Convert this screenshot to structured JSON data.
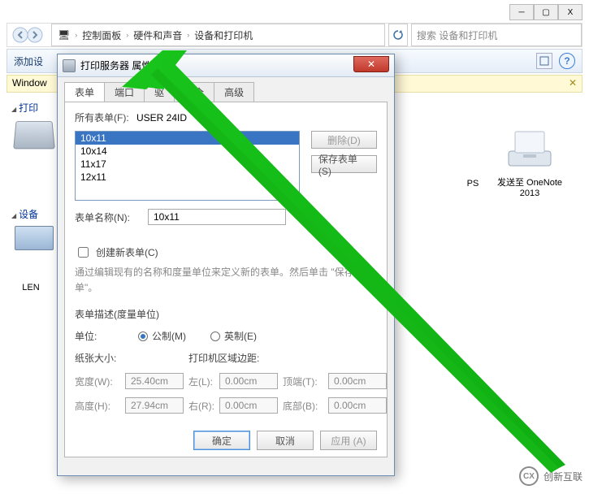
{
  "window": {
    "minimize": "─",
    "maximize": "▢",
    "close": "X"
  },
  "breadcrumb": {
    "icon": "🖥",
    "seg1": "控制面板",
    "seg2": "硬件和声音",
    "seg3": "设备和打印机",
    "sep": "›"
  },
  "search": {
    "placeholder": "搜索 设备和打印机"
  },
  "toolbar": {
    "add_device": "添加设"
  },
  "infobar": {
    "text": "Window"
  },
  "side": {
    "cat_printers": "打印",
    "cat_devices": "设备"
  },
  "devices": {
    "onenote_line1": "发送至 OneNote",
    "onenote_line2": "2013",
    "ps_suffix": "PS",
    "len_label": "LEN"
  },
  "dialog": {
    "title": "打印服务器 属性",
    "tabs": {
      "forms": "表单",
      "ports": "端口",
      "drv": "驱",
      "sec": "安全",
      "adv": "高级"
    },
    "all_forms_label": "所有表单(F):",
    "all_forms_value": "USER             24ID",
    "list": [
      "10x11",
      "10x14",
      "11x17",
      "12x11"
    ],
    "delete_btn": "删除(D)",
    "save_btn": "保存表单(S)",
    "form_name_label": "表单名称(N):",
    "form_name_value": "10x11",
    "create_checkbox": "创建新表单(C)",
    "description": "通过编辑现有的名称和度量单位来定义新的表单。然后单击 \"保存表单\"。",
    "section_title": "表单描述(度量单位)",
    "unit_label": "单位:",
    "metric_label": "公制(M)",
    "imperial_label": "英制(E)",
    "paper_size": "纸张大小:",
    "print_margin": "打印机区域边距:",
    "width_label": "宽度(W):",
    "height_label": "高度(H):",
    "left_label": "左(L):",
    "right_label": "右(R):",
    "top_label": "顶端(T):",
    "bottom_label": "底部(B):",
    "width_val": "25.40cm",
    "height_val": "27.94cm",
    "zero_val": "0.00cm",
    "ok": "确定",
    "cancel": "取消",
    "apply": "应用 (A)"
  },
  "watermark": {
    "text": "创新互联",
    "logo": "CX"
  }
}
